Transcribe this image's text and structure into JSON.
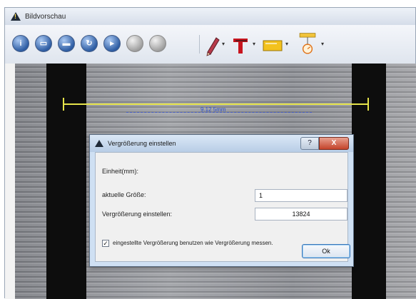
{
  "window": {
    "title": "Bildvorschau"
  },
  "toolbar": {
    "buttons": [
      {
        "icon": "info-icon",
        "glyph": "i"
      },
      {
        "icon": "page-icon",
        "glyph": "▭"
      },
      {
        "icon": "save-icon",
        "glyph": "▬"
      },
      {
        "icon": "refresh-icon",
        "glyph": "↻"
      },
      {
        "icon": "next-icon",
        "glyph": "▸"
      },
      {
        "icon": "disabled-icon-1",
        "glyph": ""
      },
      {
        "icon": "disabled-icon-2",
        "glyph": ""
      }
    ],
    "tools": [
      {
        "icon": "pencil-icon"
      },
      {
        "icon": "text-tool-icon",
        "glyph": "T"
      },
      {
        "icon": "rectangle-tool-icon"
      },
      {
        "icon": "measure-tool-icon"
      }
    ],
    "dropdown_glyph": "▾"
  },
  "image": {
    "measurement_label": "9.12 5mm"
  },
  "dialog": {
    "title": "Vergrößerung einstellen",
    "help_label": "?",
    "close_label": "X",
    "unit_label": "Einheit(mm):",
    "current_size_label": "aktuelle Größe:",
    "current_size_value": "1",
    "magnification_label": "Vergrößerung einstellen:",
    "magnification_value": "13824",
    "checkbox_checked": true,
    "checkbox_mark": "✓",
    "checkbox_label": "eingestellte Vergrößerung benutzen wie Vergrößerung messen.",
    "ok_label": "Ok"
  },
  "colors": {
    "measure_line": "#e5e34a",
    "measure_label": "#2e4fc8",
    "close_button": "#c4432a"
  }
}
